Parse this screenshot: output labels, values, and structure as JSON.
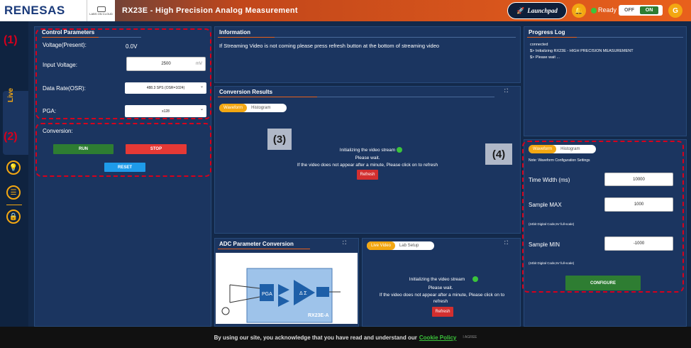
{
  "header": {
    "logo": "RENESAS",
    "labs_logo": "LABS ON CLOUD",
    "title": "RX23E - High Precision Analog Measurement",
    "launchpad": "Launchpad",
    "status": "Ready",
    "toggle_off": "OFF",
    "toggle_on": "ON",
    "avatar": "G",
    "accent": "#e8601c"
  },
  "sidebar": {
    "live_label": "Live",
    "icons": [
      "lightbulb-icon",
      "chat-icon",
      "lock-icon"
    ]
  },
  "markers": {
    "m1": "(1)",
    "m2": "(2)",
    "m3": "(3)",
    "m4": "(4)"
  },
  "control": {
    "title": "Control Parameters",
    "voltage_present_label": "Voltage(Present):",
    "voltage_present_value": "0.0V",
    "input_voltage_label": "Input Voltage:",
    "input_voltage_value": "2500",
    "input_voltage_unit": "mV",
    "data_rate_label": "Data Rate(OSR):",
    "data_rate_value": "488.3 SPS (OSR=1024)",
    "pga_label": "PGA:",
    "pga_value": "x128"
  },
  "conversion": {
    "label": "Conversion:",
    "run": "RUN",
    "stop": "STOP",
    "reset": "RESET"
  },
  "information": {
    "title": "Information",
    "text": "If Streaming Video is not coming please press refresh button at the bottom of streaming video"
  },
  "progress": {
    "title": "Progress Log",
    "lines": [
      "connected",
      "$> Initializing RX23E - HIGH PRECISION MEASUREMENT",
      "$> Please wait ..."
    ]
  },
  "results": {
    "title": "Conversion Results",
    "tab_waveform": "Waveform",
    "tab_histogram": "Histogram",
    "init": "Initializing the video stream",
    "wait": "Please wait.",
    "hint": "If the video does not appear after a minute, Please click on to refresh",
    "refresh": "Refresh"
  },
  "adc": {
    "title": "ADC Parameter Conversion",
    "chip": "RX23E-A"
  },
  "live": {
    "tab_live": "Live Video",
    "tab_lab": "Lab Setup",
    "init": "Initializing the video stream",
    "wait": "Please wait.",
    "hint1": "If the video does not appear after a minute, Please click on to",
    "hint2": "refresh",
    "refresh": "Refresh"
  },
  "config": {
    "tab_waveform": "Waveform",
    "tab_histogram": "Histogram",
    "note": "Note: Waveform Configuration Settings",
    "time_width_label": "Time Width (ms)",
    "time_width_value": "10000",
    "sample_max_label": "Sample MAX",
    "sample_max_value": "1000",
    "sample_max_hint": "(24bit Digital Code,5V full-scale)",
    "sample_min_label": "Sample MIN",
    "sample_min_value": "-1000",
    "sample_min_hint": "(24bit Digital Code,5V full-scale)",
    "configure": "CONFIGURE"
  },
  "cookie": {
    "text": "By using our site, you acknowledge that you have read and understand our",
    "link": "Cookie Policy",
    "agree": "I AGREE"
  }
}
